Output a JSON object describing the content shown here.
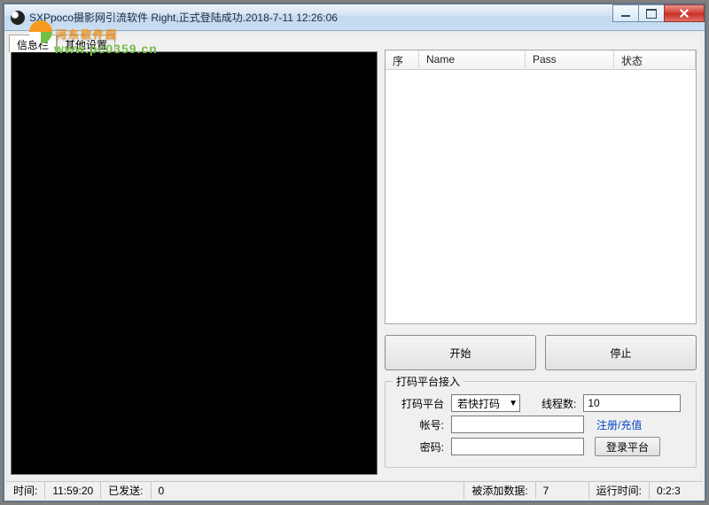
{
  "title": "SXPpoco摄影网引流软件      Right,正式登陆成功.2018-7-11 12:26:06",
  "watermark": {
    "text1": "河东软件园",
    "text2": "www.pc0359.cn"
  },
  "tabs": {
    "info": "信息栏",
    "other": "其他设置"
  },
  "table": {
    "cols": {
      "seq": "序",
      "name": "Name",
      "pass": "Pass",
      "state": "状态"
    }
  },
  "buttons": {
    "start": "开始",
    "stop": "停止",
    "login": "登录平台"
  },
  "group": {
    "legend": "打码平台接入",
    "platformLabel": "打码平台",
    "platformValue": "若快打码",
    "threadsLabel": "线程数:",
    "threadsValue": "10",
    "accountLabel": "帐号:",
    "accountValue": "",
    "passwordLabel": "密码:",
    "passwordValue": "",
    "link": "注册/充值"
  },
  "status": {
    "timeLabel": "时间:",
    "timeValue": "11:59:20",
    "sentLabel": "已发送:",
    "sentValue": "0",
    "addedLabel": "被添加数据:",
    "addedValue": "7",
    "runLabel": "运行时间:",
    "runValue": "0:2:3"
  }
}
